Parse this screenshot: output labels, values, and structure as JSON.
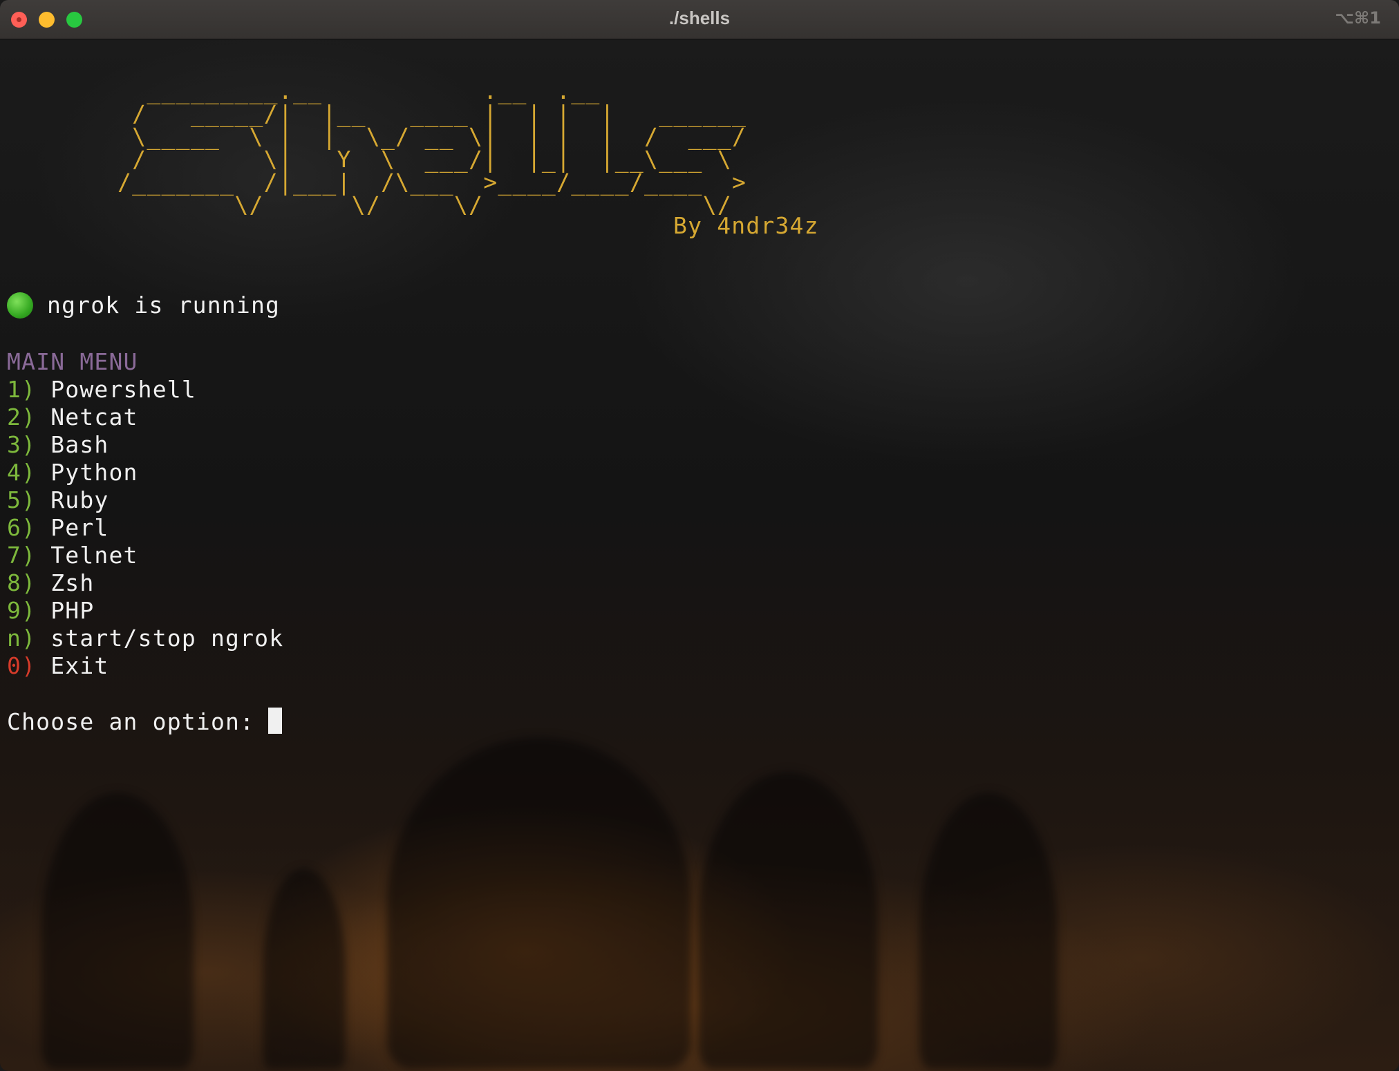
{
  "window": {
    "title": "./shells",
    "shortcut": "⌥⌘1"
  },
  "banner": {
    "ascii_art": "  _________.__           .__  .__\n /   _____/|  |__   ____ |  | |  |   ______\n \\_____  \\ |  |  \\_/ __ \\|  | |  |  /  ___/\n /        \\|   Y  \\  ___/|  |_|  |__\\___ \\\n/_______  /|___|  /\\___  >____/____/____  >\n        \\/      \\/     \\/               \\/",
    "byline": "By 4ndr34z"
  },
  "status": {
    "indicator_color": "#3bb52a",
    "text": "ngrok is running"
  },
  "menu": {
    "title": "MAIN MENU",
    "items": [
      {
        "key": "1)",
        "label": "Powershell"
      },
      {
        "key": "2)",
        "label": "Netcat"
      },
      {
        "key": "3)",
        "label": "Bash"
      },
      {
        "key": "4)",
        "label": "Python"
      },
      {
        "key": "5)",
        "label": "Ruby"
      },
      {
        "key": "6)",
        "label": "Perl"
      },
      {
        "key": "7)",
        "label": "Telnet"
      },
      {
        "key": "8)",
        "label": "Zsh"
      },
      {
        "key": "9)",
        "label": "PHP"
      },
      {
        "key": "n)",
        "label": "start/stop ngrok"
      },
      {
        "key": "0)",
        "label": "Exit"
      }
    ]
  },
  "prompt": {
    "text": "Choose an option:"
  },
  "colors": {
    "banner": "#d6a832",
    "menu_title": "#8a6a98",
    "menu_key": "#7db83c",
    "exit_key": "#d53b2a",
    "text": "#f0f0f0"
  }
}
